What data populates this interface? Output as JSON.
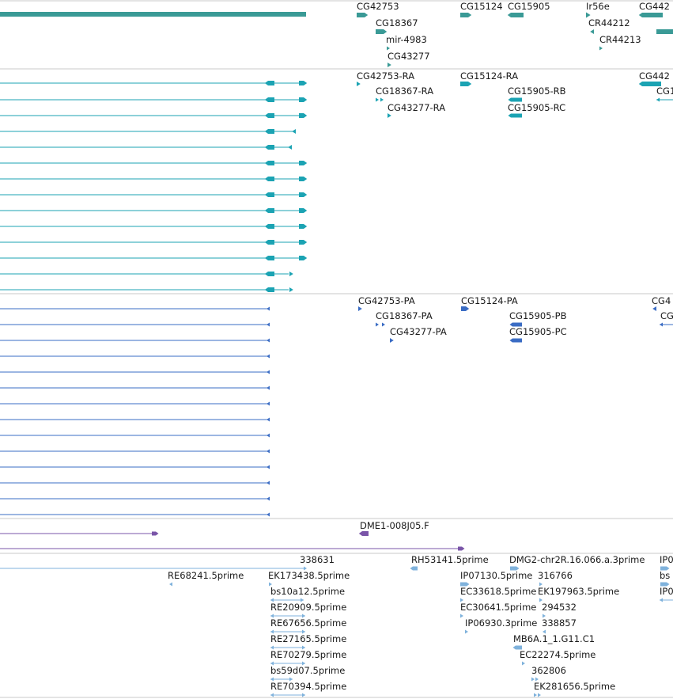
{
  "colors": {
    "gene": "#3a9a96",
    "transcript": "#1ba3b3",
    "protein": "#3a6cc4",
    "clone": "#7a55a8",
    "est": "#7fb2dc",
    "divider": "#c8c8c8"
  },
  "tracks": {
    "genes": {
      "labels": [
        "CG42753",
        "CG18367",
        "mir-4983",
        "CG43277",
        "CG15124",
        "CG15905",
        "Ir56e",
        "CR44212",
        "CR44213",
        "CG442"
      ]
    },
    "transcripts": {
      "labels": [
        "CG42753-RA",
        "CG18367-RA",
        "CG43277-RA",
        "CG15124-RA",
        "CG15905-RB",
        "CG15905-RC",
        "CG442",
        "CG1"
      ]
    },
    "proteins": {
      "labels": [
        "CG42753-PA",
        "CG18367-PA",
        "CG43277-PA",
        "CG15124-PA",
        "CG15905-PB",
        "CG15905-PC",
        "CG4",
        "CG"
      ]
    },
    "clones": {
      "labels": [
        "DME1-008J05.F"
      ]
    },
    "ests": {
      "labels": [
        "338631",
        "RH53141.5prime",
        "DMG2-chr2R.16.066.a.3prime",
        "IP0",
        "RE68241.5prime",
        "EK173438.5prime",
        "IP07130.5prime",
        "316766",
        "bs",
        "bs10a12.5prime",
        "EC33618.5prime",
        "EK197963.5prime",
        "IP0",
        "RE20909.5prime",
        "EC30641.5prime",
        "294532",
        "RE67656.5prime",
        "338857",
        "IP06930.3prime",
        "RE27165.5prime",
        "MB6A.1_1.G11.C1",
        "RE70279.5prime",
        "EC22274.5prime",
        "bs59d07.5prime",
        "362806",
        "RE70394.5prime",
        "EK281656.5prime"
      ]
    }
  }
}
